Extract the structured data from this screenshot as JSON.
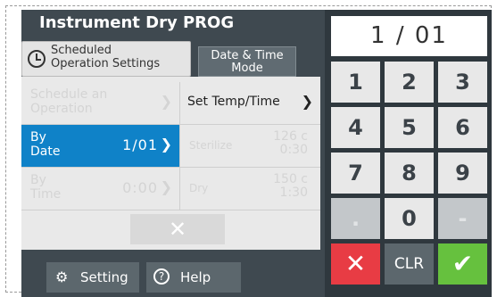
{
  "title": "Instrument Dry PROG",
  "scheduled_settings": {
    "label": "Scheduled\nOperation Settings",
    "icon": "clock-icon"
  },
  "date_time_mode": {
    "label": "Date & Time\nMode"
  },
  "schedule_operation": {
    "label": "Schedule an\nOperation"
  },
  "set_temp_time": {
    "label": "Set Temp/Time"
  },
  "by_date": {
    "label": "By\nDate",
    "value": "1/01"
  },
  "by_time": {
    "label": "By\nTime",
    "value": "0:00"
  },
  "sterilize": {
    "label": "Sterilize",
    "value": "126 c\n0:30"
  },
  "dry": {
    "label": "Dry",
    "value": "150 c\n1:30"
  },
  "clear_button": {
    "icon": "close-icon"
  },
  "setting_button": {
    "label": "Setting",
    "icon": "gear-icon"
  },
  "help_button": {
    "label": "Help",
    "icon": "help-icon"
  },
  "display": {
    "value": "1 / 01"
  },
  "keypad": {
    "keys": [
      "1",
      "2",
      "3",
      "4",
      "5",
      "6",
      "7",
      "8",
      "9",
      ".",
      "0",
      "-"
    ],
    "clr": "CLR"
  },
  "colors": {
    "active": "#0f82c8",
    "cancel": "#e83c44",
    "ok": "#66c13e",
    "panel": "#3f4950"
  }
}
